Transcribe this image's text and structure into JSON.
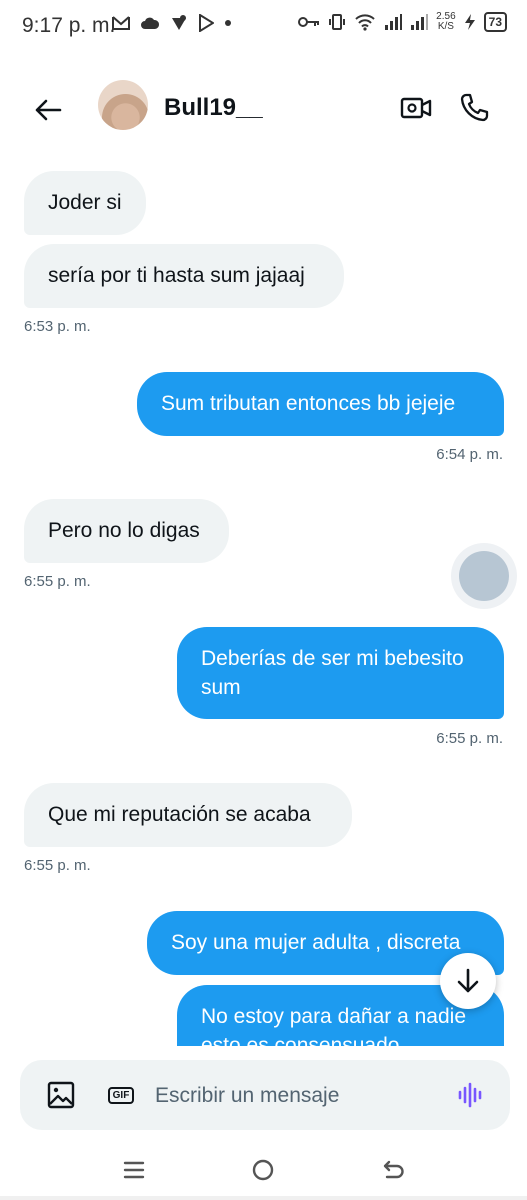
{
  "status_bar": {
    "time": "9:17 p. m.",
    "net_speed_value": "2.56",
    "net_speed_unit": "K/S",
    "battery": "73"
  },
  "header": {
    "contact_name": "Bull19__"
  },
  "messages": [
    {
      "direction": "in",
      "text": "Joder si"
    },
    {
      "direction": "in",
      "text": "sería por ti hasta sum jajaaj",
      "time": "6:53 p. m."
    },
    {
      "direction": "out",
      "text": "Sum tributan entonces bb jejeje",
      "time": "6:54 p. m."
    },
    {
      "direction": "in",
      "text": "Pero no lo digas",
      "time": "6:55 p. m."
    },
    {
      "direction": "out",
      "text": "Deberías de ser mi bebesito sum",
      "time": "6:55 p. m."
    },
    {
      "direction": "in",
      "text": "Que mi reputación se acaba",
      "time": "6:55 p. m."
    },
    {
      "direction": "out",
      "text": "Soy una mujer adulta , discreta"
    },
    {
      "direction": "out",
      "text": "No estoy para dañar a nadie esto es consensuado"
    }
  ],
  "composer": {
    "placeholder": "Escribir un mensaje",
    "gif_label": "GIF"
  },
  "colors": {
    "outgoing_bubble": "#1d9bf0",
    "incoming_bubble": "#eff3f4",
    "voice_accent": "#7856ff"
  }
}
